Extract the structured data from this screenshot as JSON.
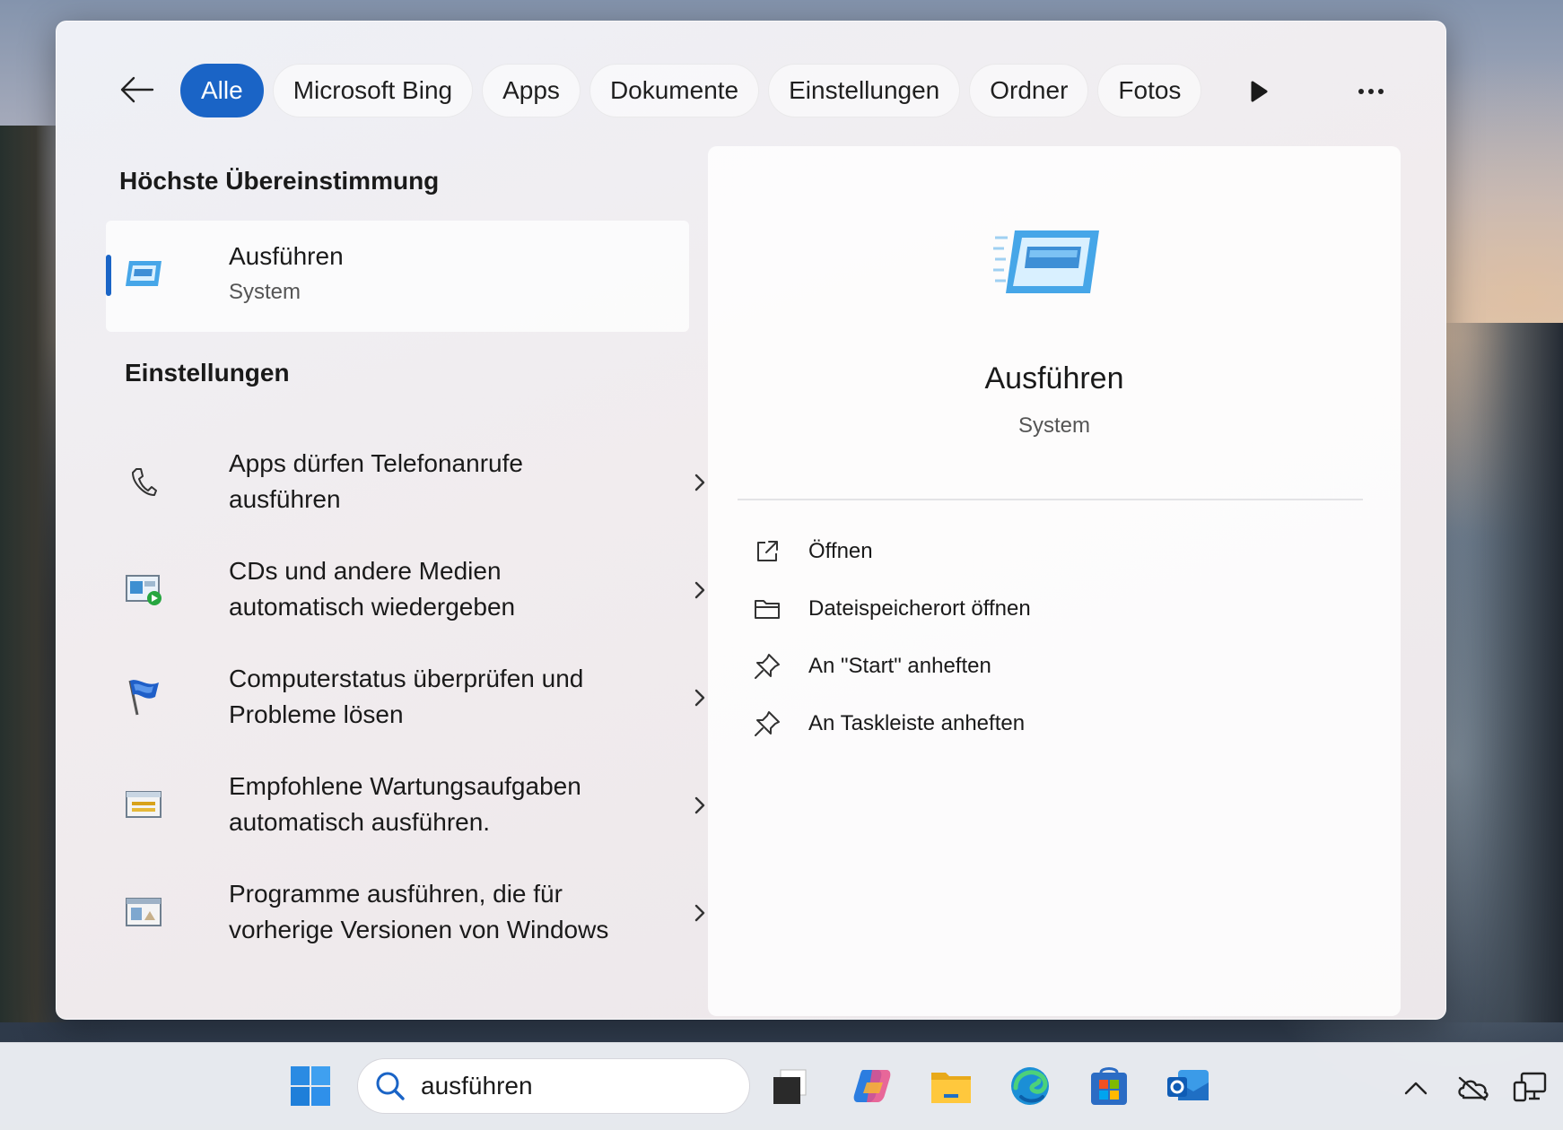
{
  "flyout": {
    "filters": [
      {
        "label": "Alle",
        "active": true
      },
      {
        "label": "Microsoft Bing",
        "active": false
      },
      {
        "label": "Apps",
        "active": false
      },
      {
        "label": "Dokumente",
        "active": false
      },
      {
        "label": "Einstellungen",
        "active": false
      },
      {
        "label": "Ordner",
        "active": false
      },
      {
        "label": "Fotos",
        "active": false
      }
    ],
    "accent_color": "#1a64c6"
  },
  "best_match": {
    "heading": "Höchste Übereinstimmung",
    "title": "Ausführen",
    "subtitle": "System",
    "icon": "run-dialog-icon"
  },
  "settings": {
    "heading": "Einstellungen",
    "items": [
      {
        "label": "Apps dürfen Telefonanrufe ausführen",
        "icon": "phone-icon"
      },
      {
        "label": "CDs und andere Medien automatisch wiedergeben",
        "icon": "autoplay-icon"
      },
      {
        "label": "Computerstatus überprüfen und Probleme lösen",
        "icon": "security-flag-icon"
      },
      {
        "label": "Empfohlene Wartungsaufgaben automatisch ausführen.",
        "icon": "maintenance-icon"
      },
      {
        "label": "Programme ausführen, die für vorherige Versionen von Windows",
        "icon": "compatibility-icon"
      }
    ]
  },
  "detail": {
    "title": "Ausführen",
    "subtitle": "System",
    "actions": [
      {
        "label": "Öffnen",
        "icon": "open-external-icon"
      },
      {
        "label": "Dateispeicherort öffnen",
        "icon": "folder-icon"
      },
      {
        "label": "An \"Start\" anheften",
        "icon": "pin-icon"
      },
      {
        "label": "An Taskleiste anheften",
        "icon": "pin-icon"
      }
    ]
  },
  "taskbar": {
    "search_value": "ausführen",
    "apps": [
      "windows-start-icon",
      "task-view-icon",
      "copilot-icon",
      "file-explorer-icon",
      "edge-icon",
      "store-icon",
      "outlook-icon"
    ],
    "tray": [
      "chevron-up-icon",
      "onedrive-offline-icon",
      "network-icon"
    ]
  }
}
